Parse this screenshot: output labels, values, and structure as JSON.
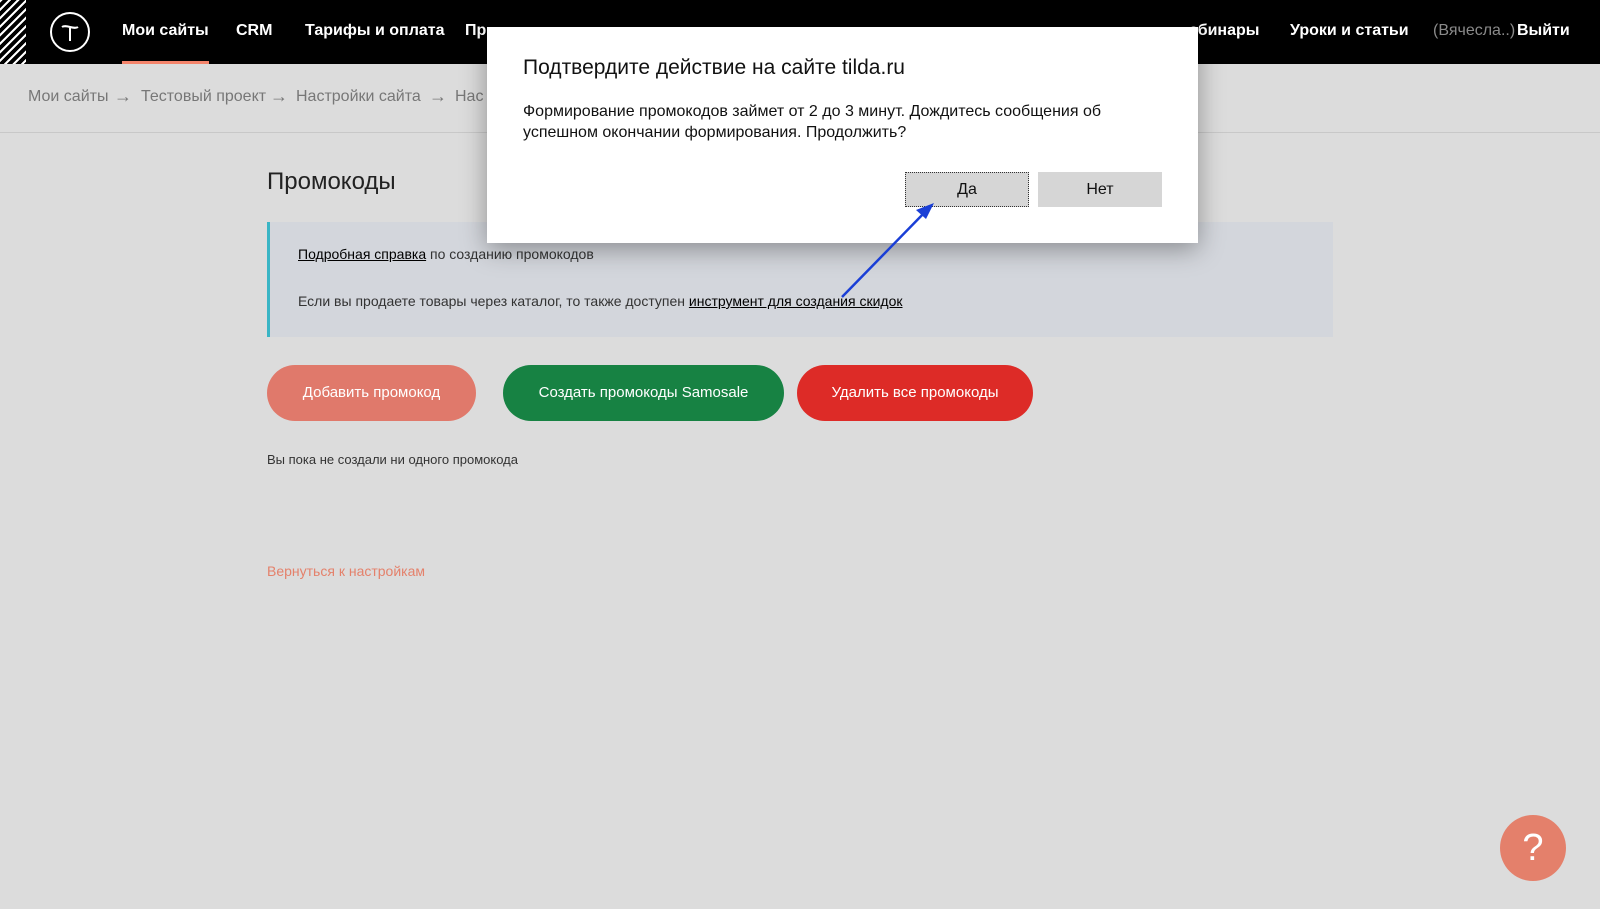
{
  "nav": {
    "items": [
      {
        "label": "Мои сайты",
        "active": true
      },
      {
        "label": "CRM"
      },
      {
        "label": "Тарифы и оплата"
      },
      {
        "label": "Пр"
      },
      {
        "label": "ебинары"
      },
      {
        "label": "Уроки и статьи"
      }
    ],
    "user": "(Вячесла..)",
    "logout": "Выйти"
  },
  "breadcrumb": {
    "items": [
      "Мои сайты",
      "Тестовый проект",
      "Настройки сайта",
      "Нас"
    ],
    "separator": "→"
  },
  "main": {
    "title": "Промокоды",
    "info": {
      "line1_link": "Подробная справка",
      "line1_text": " по созданию промокодов",
      "line2_text": "Если вы продаете товары через каталог, то также доступен ",
      "line2_link": "инструмент для создания скидок"
    },
    "buttons": {
      "add": "Добавить промокод",
      "samosale": "Создать промокоды Samosale",
      "delete_all": "Удалить все промокоды"
    },
    "empty_text": "Вы пока не создали ни одного промокода",
    "back_link": "Вернуться к настройкам"
  },
  "help": {
    "icon": "question-mark-icon",
    "glyph": "?"
  },
  "dialog": {
    "title": "Подтвердите действие на сайте tilda.ru",
    "message": "Формирование промокодов займет от 2 до 3 минут. Дождитесь сообщения об успешном окончании формирования. Продолжить?",
    "yes": "Да",
    "no": "Нет"
  },
  "colors": {
    "accent": "#f4846b",
    "add_button": "#e0796b",
    "samosale_button": "#178243",
    "delete_button": "#dd2b27",
    "info_border": "#3ab5c5",
    "annotation_arrow": "#1a3fd6"
  }
}
